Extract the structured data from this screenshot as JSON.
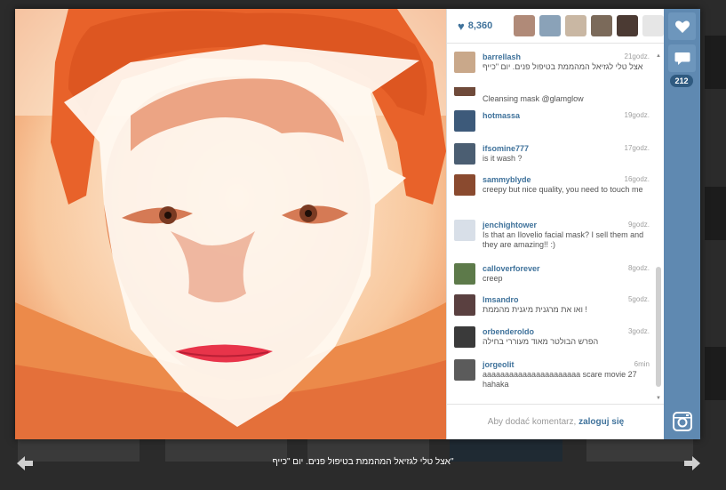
{
  "likes": {
    "count": "8,360"
  },
  "comment_count": "212",
  "comments": [
    {
      "user": "barrellash",
      "time": "21godz.",
      "text": "אצל טלי לגזיאל המהממת בטיפול פנים. יום \"כייף",
      "avatar_color": "#c9a88a"
    },
    {
      "user": "",
      "time": "",
      "text": "Cleansing mask @glamglow",
      "avatar_color": "#6f4a3a"
    },
    {
      "user": "hotmassa",
      "time": "19godz.",
      "text": "",
      "avatar_color": "#3d5a7a"
    },
    {
      "user": "ifsomine777",
      "time": "17godz.",
      "text": "is it wash ?",
      "avatar_color": "#4b5e72"
    },
    {
      "user": "sammyblyde",
      "time": "16godz.",
      "text": "creepy but nice quality, you need to touch me",
      "avatar_color": "#8a4a2f"
    },
    {
      "user": "jenchightower",
      "time": "9godz.",
      "text": "Is that an Ilovelio facial mask? I sell them and they are amazing!! :)",
      "avatar_color": "#d8dfe8"
    },
    {
      "user": "calloverforever",
      "time": "8godz.",
      "text": "creep",
      "avatar_color": "#5d7a4a"
    },
    {
      "user": "lmsandro",
      "time": "5godz.",
      "text": "! ואו את מרגנית מיגנית מהממת",
      "avatar_color": "#5a4040"
    },
    {
      "user": "orbenderoldo",
      "time": "3godz.",
      "text": "הפרש הבולטר מאוד מעוררי בחילה",
      "avatar_color": "#3a3a3a"
    },
    {
      "user": "jorgeolit",
      "time": "6min",
      "text": "aaaaaaaaaaaaaaaaaaaaaa scare movie 27 hahaka",
      "avatar_color": "#5b5b5b"
    }
  ],
  "add_comment": {
    "prompt": "Aby dodać komentarz,",
    "login": "zaloguj się"
  },
  "caption": "\"אצל טלי לגזיאל המהממת בטיפול פנים. יום \"כייף",
  "colors": {
    "accent": "#3f729b",
    "action_bar": "#5f89b1"
  },
  "icons": {
    "like": "heart-icon",
    "comment": "speech-bubble-icon",
    "instagram": "instagram-icon",
    "prev": "arrow-left-icon",
    "next": "arrow-right-icon"
  }
}
